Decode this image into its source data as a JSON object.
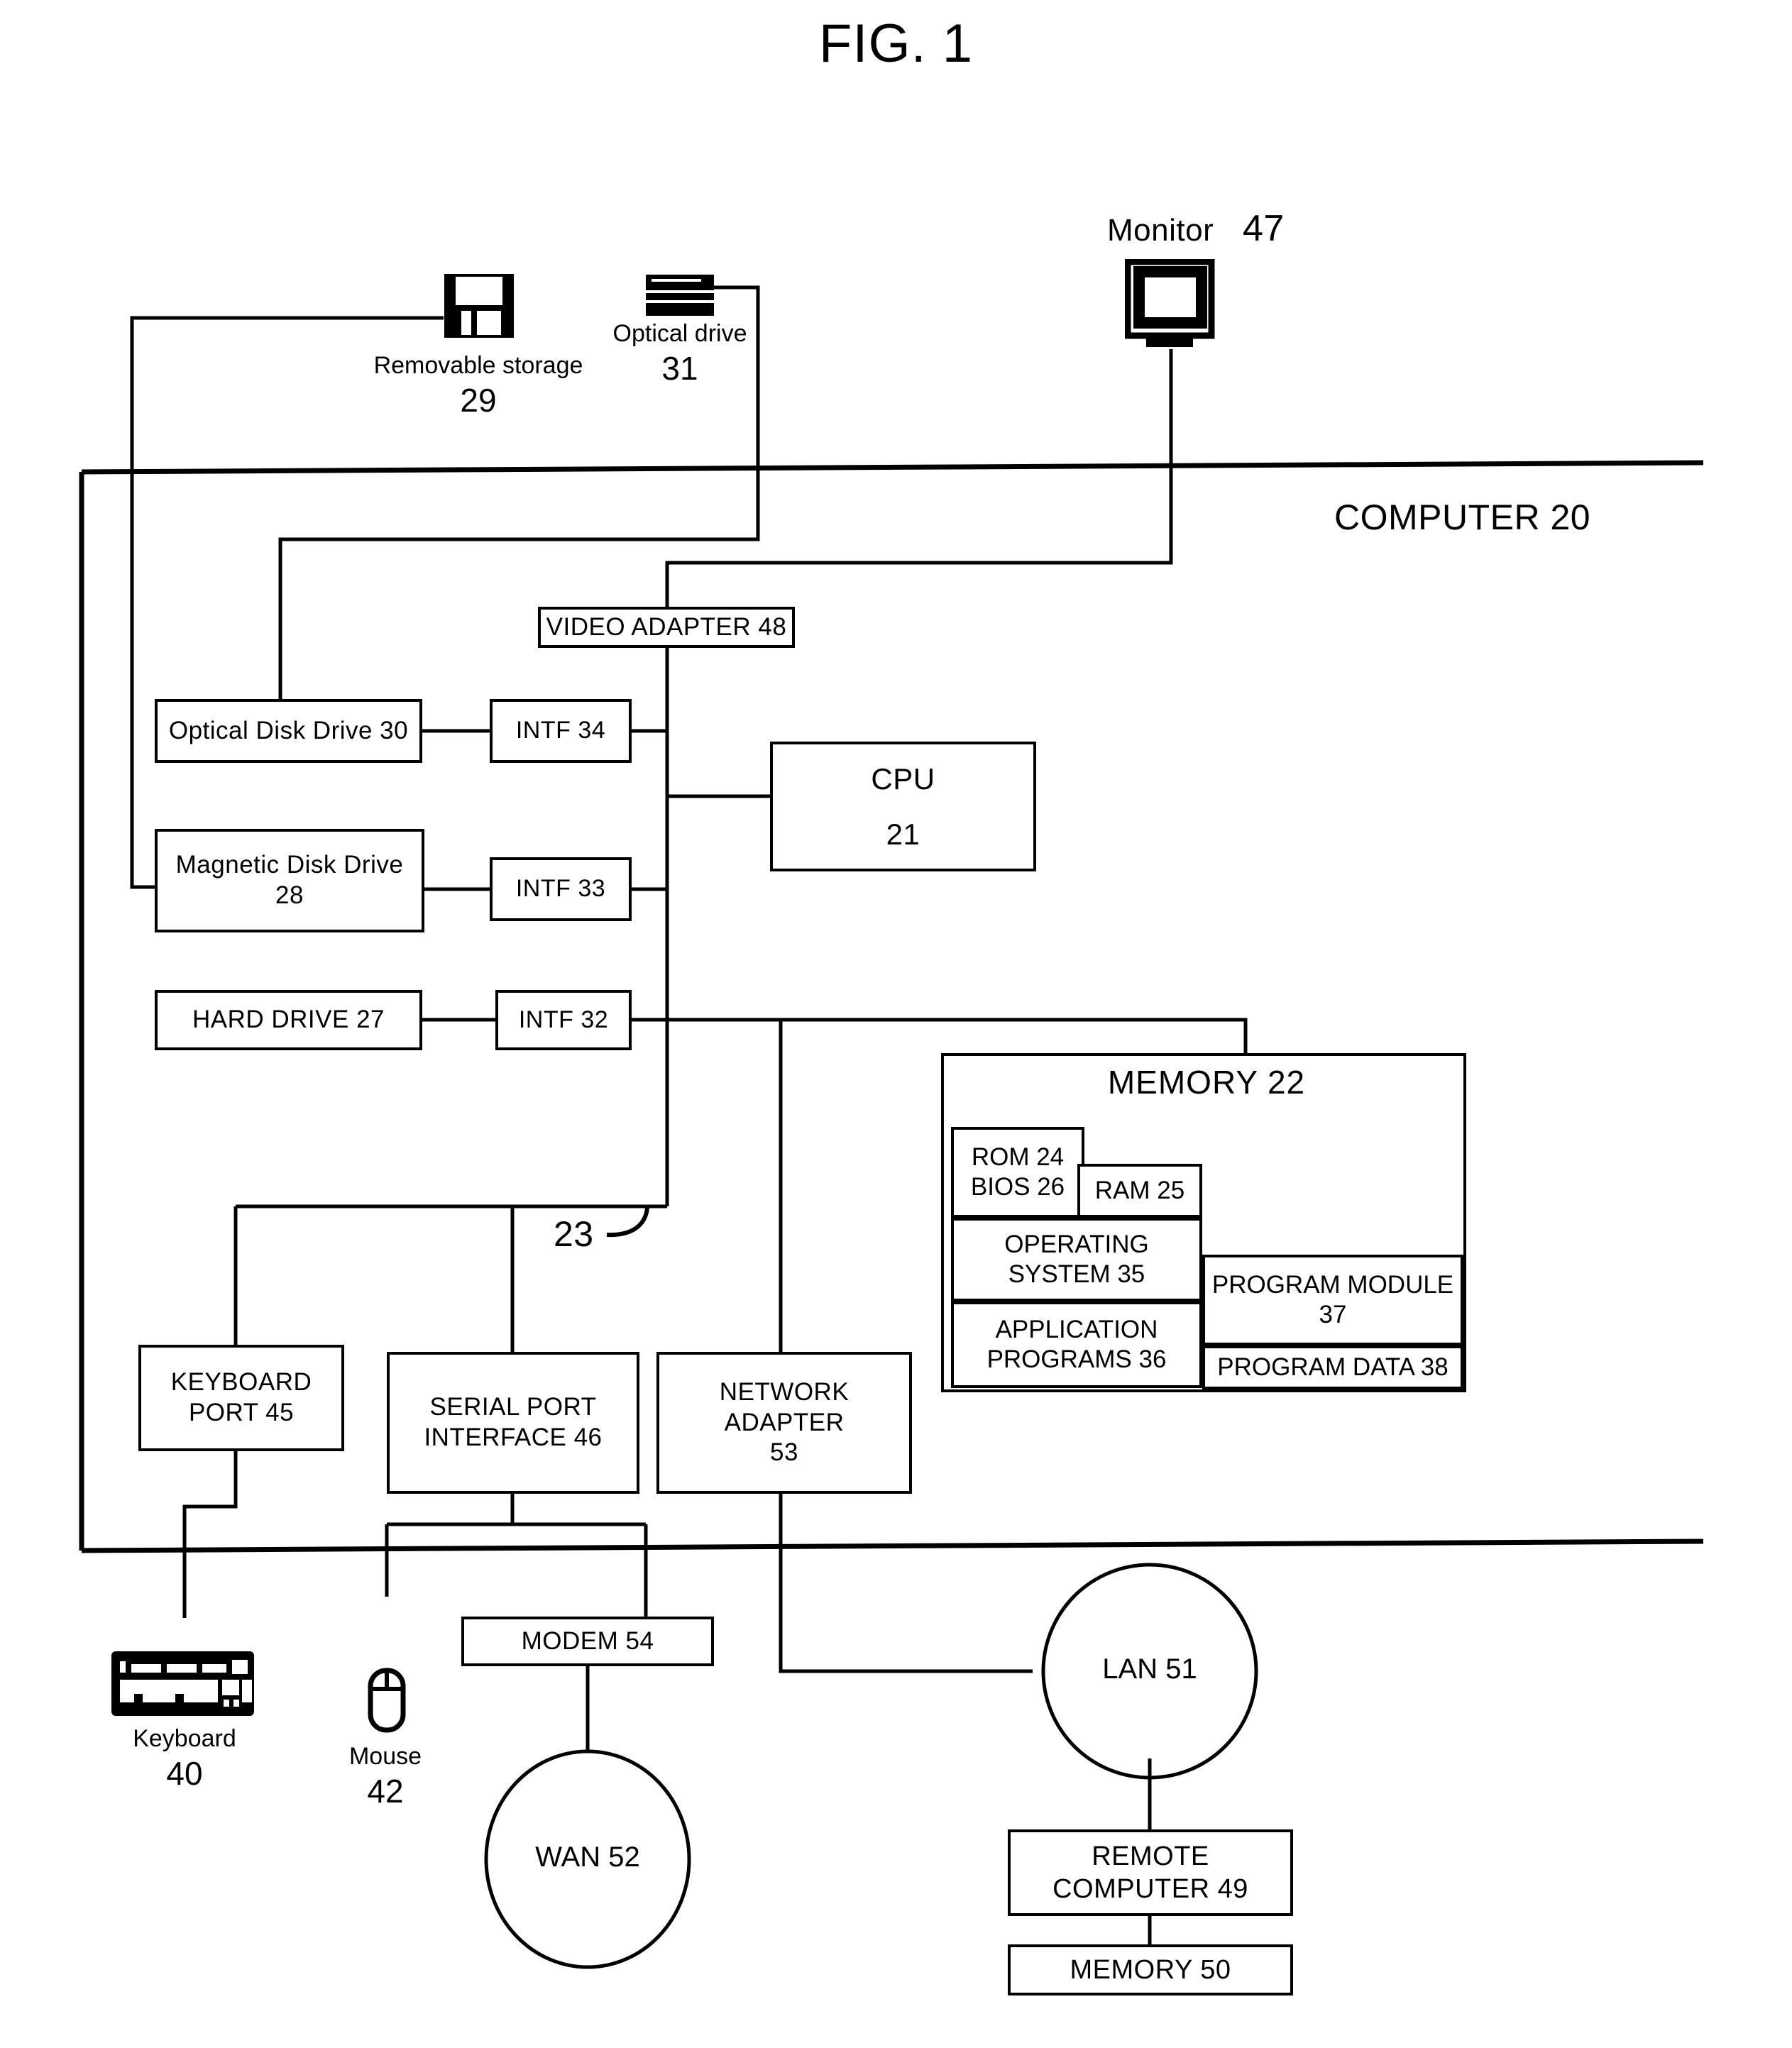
{
  "figure": {
    "title": "FIG. 1"
  },
  "peripherals": {
    "removable_storage": {
      "label": "Removable storage",
      "number": "29",
      "icon": "floppy-disk-icon"
    },
    "optical_drive": {
      "label": "Optical drive",
      "number": "31",
      "icon": "optical-drive-icon"
    },
    "monitor": {
      "label": "Monitor",
      "number": "47",
      "icon": "crt-monitor-icon"
    },
    "keyboard": {
      "label": "Keyboard",
      "number": "40",
      "icon": "keyboard-icon"
    },
    "mouse": {
      "label": "Mouse",
      "number": "42",
      "icon": "mouse-icon"
    }
  },
  "computer": {
    "boundary_label": "COMPUTER 20",
    "bus_label": "23",
    "blocks": {
      "video_adapter": "VIDEO ADAPTER 48",
      "optical_disk_drive": "Optical Disk Drive  30",
      "intf34": "INTF 34",
      "magnetic_disk_drive_line1": "Magnetic Disk Drive",
      "magnetic_disk_drive_line2": "28",
      "intf33": "INTF 33",
      "hard_drive": "HARD DRIVE  27",
      "intf32": "INTF 32",
      "cpu_line1": "CPU",
      "cpu_line2": "21",
      "keyboard_port_line1": "KEYBOARD",
      "keyboard_port_line2": "PORT 45",
      "serial_port_line1": "SERIAL PORT",
      "serial_port_line2": "INTERFACE 46",
      "network_adapter_line1": "NETWORK ADAPTER",
      "network_adapter_line2": "53"
    },
    "memory": {
      "title": "MEMORY 22",
      "rom_line1": "ROM  24",
      "rom_line2": "BIOS  26",
      "ram": "RAM  25",
      "os_line1": "OPERATING",
      "os_line2": "SYSTEM  35",
      "apps_line1": "APPLICATION",
      "apps_line2": "PROGRAMS  36",
      "program_module_line1": "PROGRAM MODULE",
      "program_module_line2": "37",
      "program_data": "PROGRAM DATA  38"
    }
  },
  "network": {
    "modem": "MODEM  54",
    "wan": "WAN 52",
    "lan": "LAN  51",
    "remote_computer_line1": "REMOTE",
    "remote_computer_line2": "COMPUTER  49",
    "remote_memory": "MEMORY  50"
  },
  "colors": {
    "ink": "#000000",
    "paper": "#ffffff"
  }
}
